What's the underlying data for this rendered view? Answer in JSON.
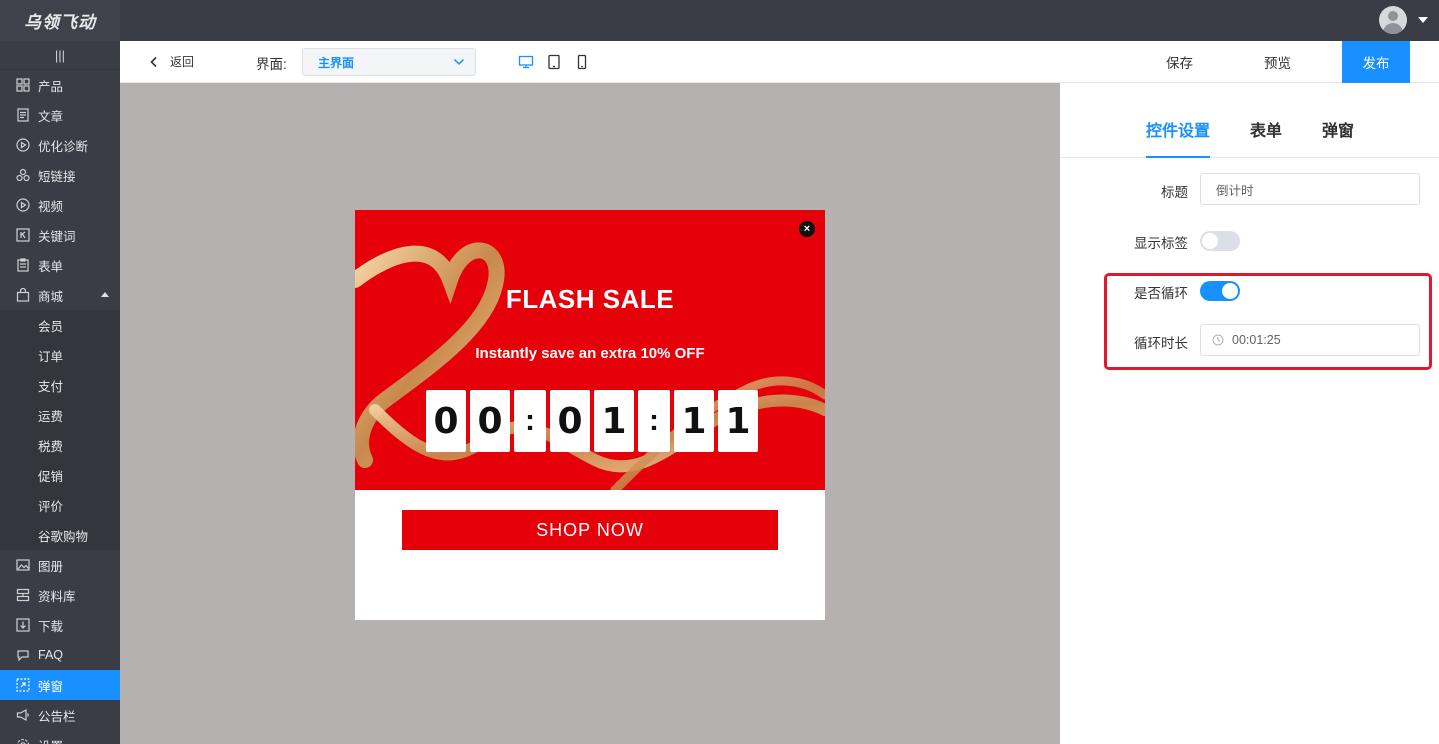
{
  "app": {
    "logo_text": "乌领飞动"
  },
  "sidebar": {
    "collapse_glyph": "|||",
    "items": [
      {
        "label": "产品",
        "icon": "grid-icon"
      },
      {
        "label": "文章",
        "icon": "document-icon"
      },
      {
        "label": "优化诊断",
        "icon": "play-circle-icon"
      },
      {
        "label": "短链接",
        "icon": "link-icon"
      },
      {
        "label": "视频",
        "icon": "video-icon"
      },
      {
        "label": "关键词",
        "icon": "keyword-icon"
      },
      {
        "label": "表单",
        "icon": "clipboard-icon"
      },
      {
        "label": "商城",
        "icon": "shopping-bag-icon",
        "expanded": true
      },
      {
        "label": "会员"
      },
      {
        "label": "订单"
      },
      {
        "label": "支付"
      },
      {
        "label": "运费"
      },
      {
        "label": "税费"
      },
      {
        "label": "促销"
      },
      {
        "label": "评价"
      },
      {
        "label": "谷歌购物"
      },
      {
        "label": "图册",
        "icon": "gallery-icon"
      },
      {
        "label": "资料库",
        "icon": "database-icon"
      },
      {
        "label": "下载",
        "icon": "download-icon"
      },
      {
        "label": "FAQ",
        "icon": "chat-icon"
      },
      {
        "label": "弹窗",
        "icon": "popup-icon",
        "active": true
      },
      {
        "label": "公告栏",
        "icon": "megaphone-icon"
      },
      {
        "label": "设置",
        "icon": "gear-icon"
      }
    ]
  },
  "toolbar": {
    "back_label": "返回",
    "interface_label": "界面:",
    "interface_value": "主界面",
    "save_label": "保存",
    "preview_label": "预览",
    "publish_label": "发布"
  },
  "popup": {
    "title": "FLASH SALE",
    "subtitle": "Instantly save an extra 10% OFF",
    "countdown": [
      "0",
      "0",
      ":",
      "0",
      "1",
      ":",
      "1",
      "1"
    ],
    "cta_label": "SHOP NOW",
    "close_glyph": "×"
  },
  "panel": {
    "tabs": [
      "控件设置",
      "表单",
      "弹窗"
    ],
    "active_tab": 0,
    "fields": {
      "title_label": "标题",
      "title_value": "倒计时",
      "show_tag_label": "显示标签",
      "show_tag_on": false,
      "loop_label": "是否循环",
      "loop_on": true,
      "loop_duration_label": "循环时长",
      "loop_duration_value": "00:01:25"
    }
  },
  "colors": {
    "accent": "#1890ff",
    "sidebar_bg": "#3a3d45",
    "popup_red": "#e60009",
    "highlight_red": "#e2172b",
    "canvas_gray": "#b5b1b1"
  }
}
